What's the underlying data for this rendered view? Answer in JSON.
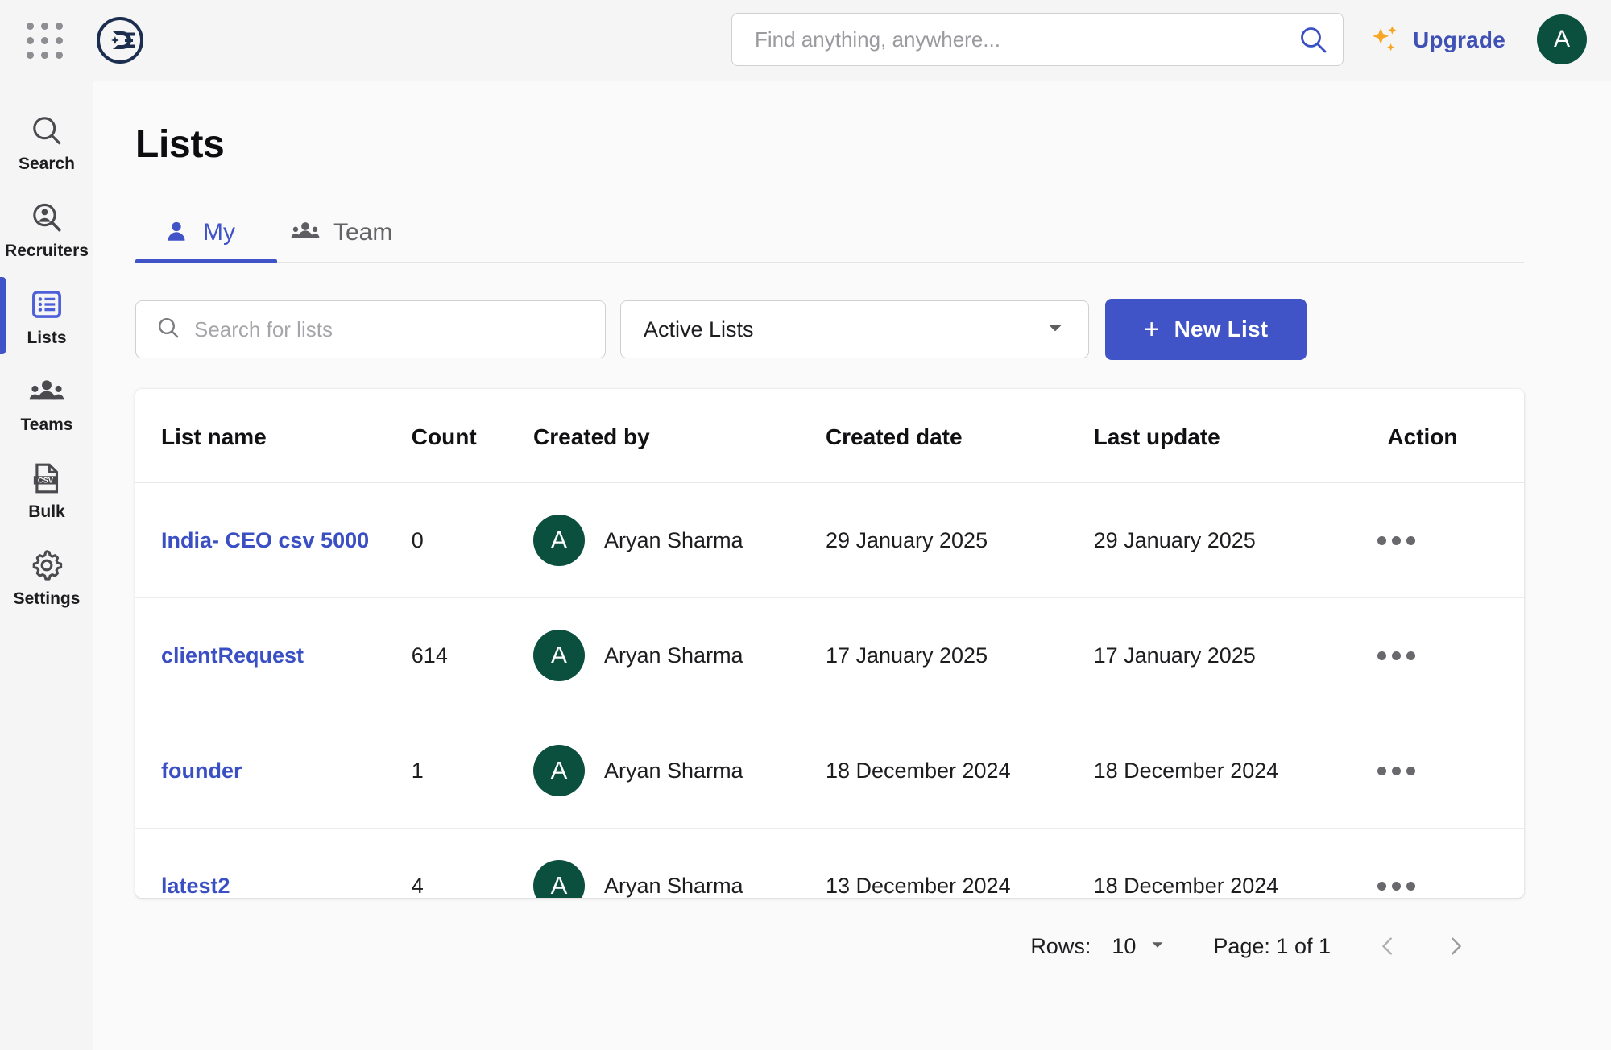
{
  "topbar": {
    "grid_menu_icon": "apps-grid-icon",
    "logo_icon": "de-brand-logo",
    "search": {
      "placeholder": "Find anything, anywhere...",
      "value": "",
      "icon": "search-icon"
    },
    "upgrade": {
      "label": "Upgrade",
      "icon": "sparkle-icon",
      "color": "#3f51b5"
    },
    "avatar": {
      "initial": "A",
      "color": "#0b4f3f"
    }
  },
  "sidebar": {
    "active_color": "#4054c8",
    "items": [
      {
        "label": "Search",
        "icon": "search-icon",
        "active": false
      },
      {
        "label": "Recruiters",
        "icon": "person-search-icon",
        "active": false
      },
      {
        "label": "Lists",
        "icon": "list-icon",
        "active": true
      },
      {
        "label": "Teams",
        "icon": "people-icon",
        "active": false
      },
      {
        "label": "Bulk",
        "icon": "csv-file-icon",
        "active": false
      },
      {
        "label": "Settings",
        "icon": "gear-icon",
        "active": false
      }
    ]
  },
  "main": {
    "title": "Lists",
    "tabs": [
      {
        "label": "My",
        "icon": "person-icon",
        "active": true
      },
      {
        "label": "Team",
        "icon": "people-icon",
        "active": false
      }
    ],
    "toolbar": {
      "search": {
        "placeholder": "Search for lists",
        "value": "",
        "icon": "search-icon"
      },
      "filter": {
        "value": "Active Lists",
        "icon": "chevron-down-icon"
      },
      "new_list": {
        "label": "New List",
        "icon": "plus-icon",
        "color": "#4054c8"
      }
    },
    "table": {
      "columns": [
        "List name",
        "Count",
        "Created by",
        "Created date",
        "Last update",
        "Action"
      ],
      "rows": [
        {
          "name": "India- CEO csv 5000",
          "count": "0",
          "created_by": "Aryan Sharma",
          "avatar_initial": "A",
          "created_date": "29 January 2025",
          "last_update": "29 January 2025",
          "action": "more-options"
        },
        {
          "name": "clientRequest",
          "count": "614",
          "created_by": "Aryan Sharma",
          "avatar_initial": "A",
          "created_date": "17 January 2025",
          "last_update": "17 January 2025",
          "action": "more-options"
        },
        {
          "name": "founder",
          "count": "1",
          "created_by": "Aryan Sharma",
          "avatar_initial": "A",
          "created_date": "18 December 2024",
          "last_update": "18 December 2024",
          "action": "more-options"
        },
        {
          "name": "latest2",
          "count": "4",
          "created_by": "Aryan Sharma",
          "avatar_initial": "A",
          "created_date": "13 December 2024",
          "last_update": "18 December 2024",
          "action": "more-options"
        }
      ]
    },
    "pagination": {
      "rows_label": "Rows:",
      "rows_value": "10",
      "page_label": "Page: 1 of 1",
      "prev_icon": "chevron-left-icon",
      "next_icon": "chevron-right-icon"
    }
  }
}
